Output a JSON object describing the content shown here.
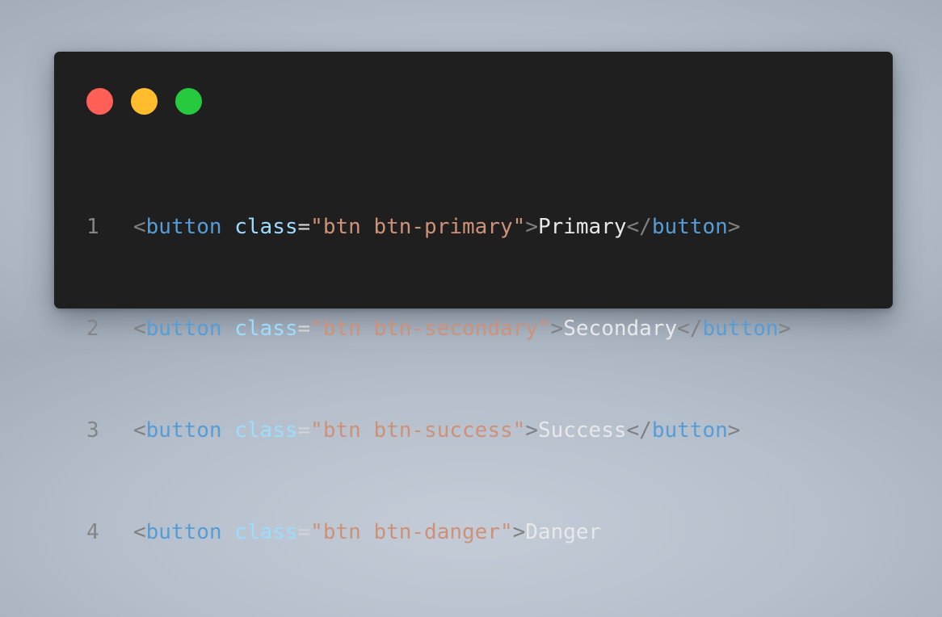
{
  "window": {
    "controls": [
      {
        "name": "close",
        "color": "#ff5f56"
      },
      {
        "name": "minimize",
        "color": "#ffbd2e"
      },
      {
        "name": "maximize",
        "color": "#27c93f"
      }
    ]
  },
  "code": {
    "lines": [
      {
        "number": "1",
        "open": "<",
        "tag": "button",
        "space": " ",
        "attr": "class",
        "eq": "=",
        "value": "\"btn btn-primary\"",
        "close": ">",
        "text": "Primary",
        "end_open": "</",
        "end_tag": "button",
        "end_close": ">"
      },
      {
        "number": "2",
        "open": "<",
        "tag": "button",
        "space": " ",
        "attr": "class",
        "eq": "=",
        "value": "\"btn btn-secondary\"",
        "close": ">",
        "text": "Secondary",
        "end_open": "</",
        "end_tag": "button",
        "end_close": ">"
      },
      {
        "number": "3",
        "open": "<",
        "tag": "button",
        "space": " ",
        "attr": "class",
        "eq": "=",
        "value": "\"btn btn-success\"",
        "close": ">",
        "text": "Success",
        "end_open": "</",
        "end_tag": "button",
        "end_close": ">"
      },
      {
        "number": "4",
        "open": "<",
        "tag": "button",
        "space": " ",
        "attr": "class",
        "eq": "=",
        "value": "\"btn btn-danger\"",
        "close": ">",
        "text": "Danger",
        "end_open": "",
        "end_tag": "",
        "end_close": ""
      }
    ]
  }
}
